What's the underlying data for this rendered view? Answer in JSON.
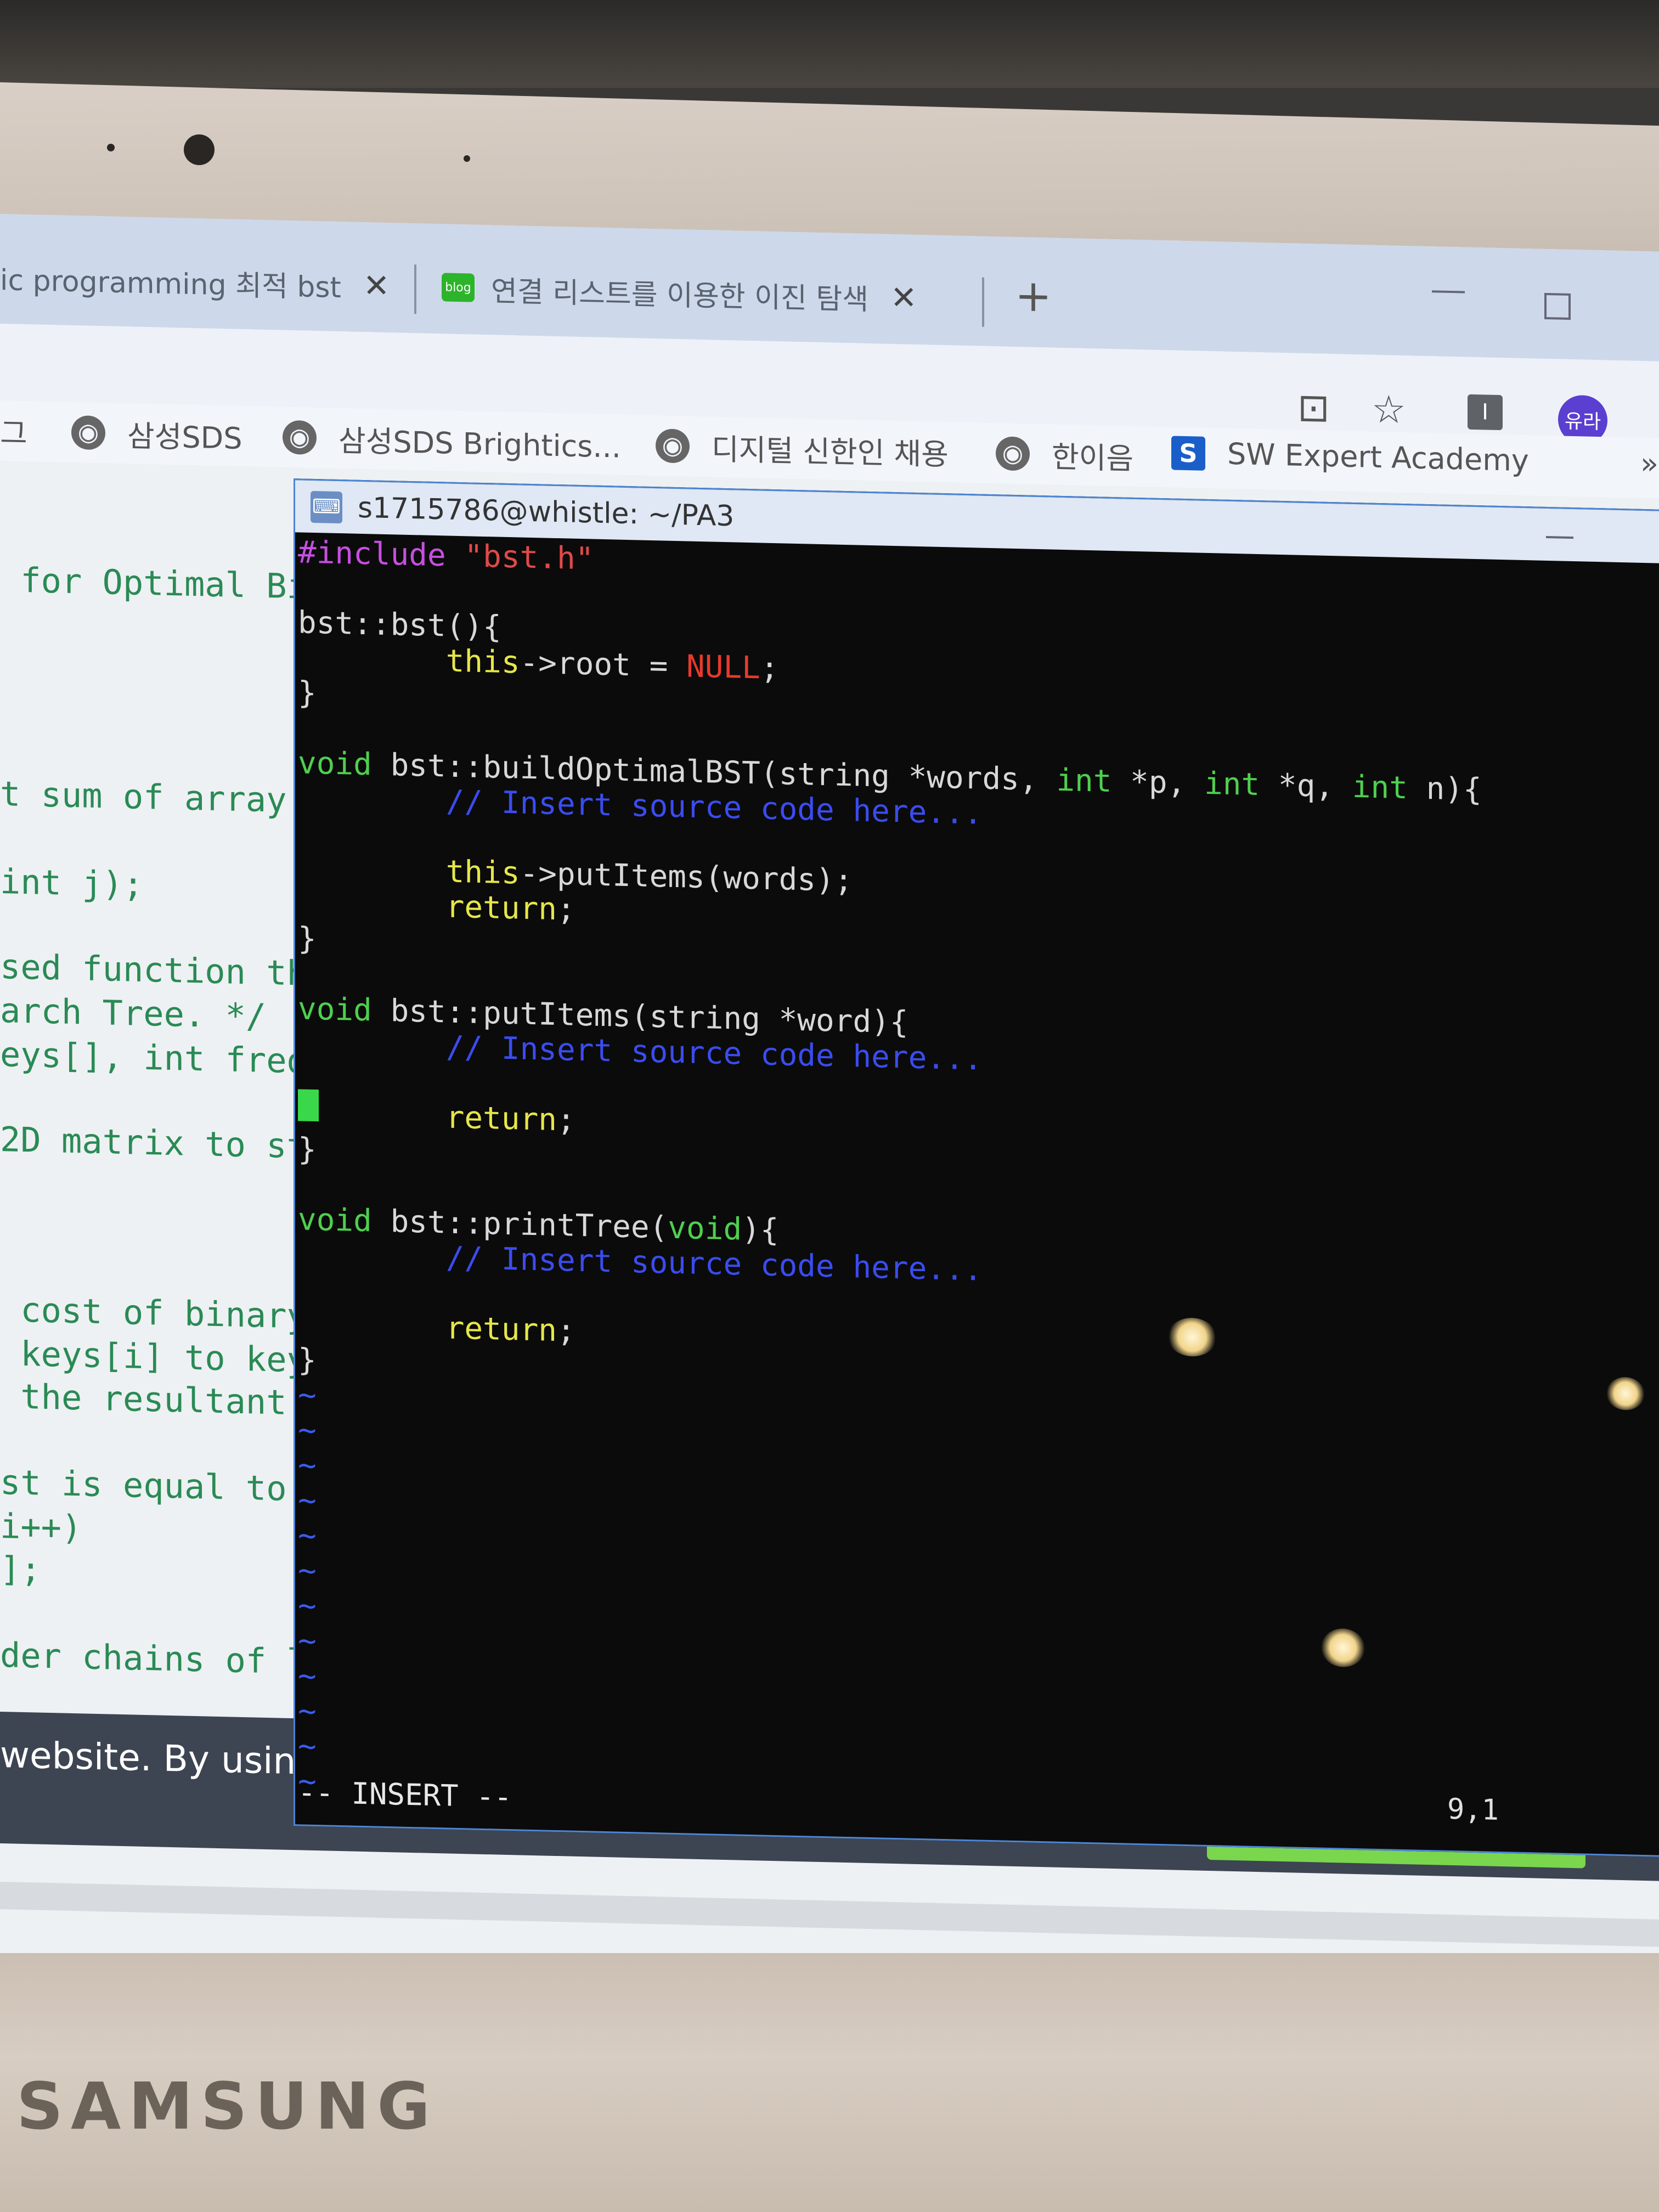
{
  "browser": {
    "tabs": [
      {
        "title": "ic programming 최적 bst",
        "close": "✕"
      },
      {
        "title": "연결 리스트를 이용한 이진 탐색",
        "close": "✕",
        "badge": "blog"
      }
    ],
    "new_tab": "+",
    "profile": "유라",
    "ext_label": "I",
    "bookmarks": [
      "그",
      "삼성SDS",
      "삼성SDS Brightics...",
      "디지털 신한인 채용",
      "한이음",
      "SW Expert Academy"
    ],
    "bookmark_badge": "S",
    "more": "»"
  },
  "page": {
    "lines": [
      " for Optimal Bi",
      "t sum of array",
      "int j);",
      "sed function th",
      "arch Tree. */",
      "eys[], int fred",
      "2D matrix to st",
      " cost of binary",
      " keys[i] to key",
      " the resultant ",
      "st is equal to ",
      "i++)",
      "];",
      "der chains of l"
    ],
    "cookie_text": "website. By using"
  },
  "terminal": {
    "title": "s1715786@whistle: ~/PA3",
    "lines": {
      "l1_pp": "#include",
      "l1_str": " \"bst.h\"",
      "l3": "bst::bst(){",
      "l4_this": "        this",
      "l4_rest": "->root = ",
      "l4_null": "NULL",
      "l4_end": ";",
      "l5": "}",
      "l7_kw": "void",
      "l7_a": " bst::buildOptimalBST(string *words, ",
      "l7_kw2": "int",
      "l7_b": " *p, ",
      "l7_kw3": "int",
      "l7_c": " *q, ",
      "l7_kw4": "int",
      "l7_d": " n){",
      "l8_cm": "        // Insert source code here...",
      "l10_this": "        this",
      "l10_rest": "->putItems(words);",
      "l11_kw": "        return",
      "l11_end": ";",
      "l12": "}",
      "l14_kw": "void",
      "l14_rest": " bst::putItems(string *word){",
      "l15_cm": "        // Insert source code here...",
      "l17_kw": "        return",
      "l17_end": ";",
      "l18": "}",
      "l20_kw": "void",
      "l20_a": " bst::printTree(",
      "l20_kw2": "void",
      "l20_b": "){",
      "l21_cm": "        // Insert source code here...",
      "l23_kw": "        return",
      "l23_end": ";",
      "l24": "}",
      "tilde": "~"
    },
    "mode": "-- INSERT --",
    "position": "9,1"
  },
  "device": {
    "brand": "SAMSUNG"
  }
}
